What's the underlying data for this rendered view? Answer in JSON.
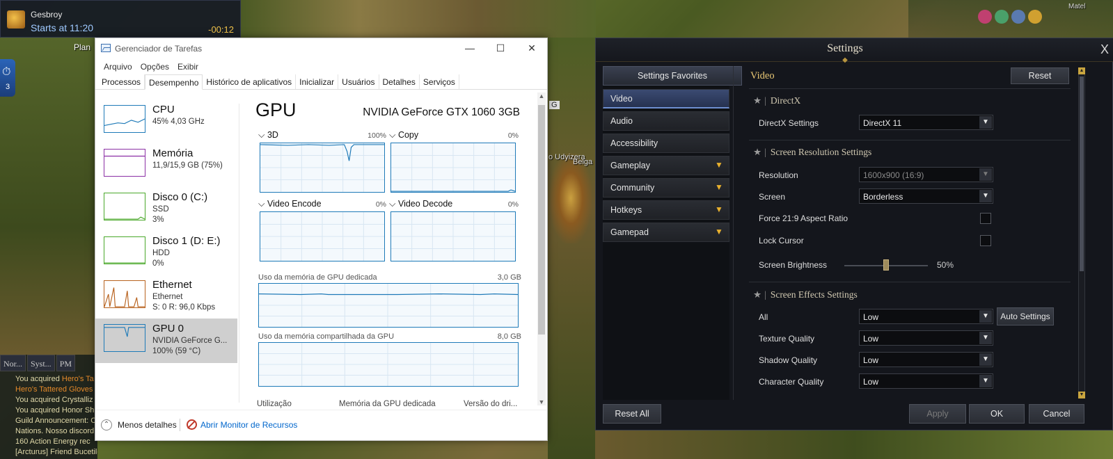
{
  "game_hud": {
    "event_name": "Gesbroy",
    "event_starts": "Starts at 11:20",
    "event_countdown": "-00:12",
    "plan_label": "Plan",
    "left_icon_count": "3",
    "chat_tabs": [
      "Nor...",
      "Syst...",
      "PM"
    ],
    "chat_lines": [
      {
        "text": "You acquired ",
        "hl": "Hero's Ta"
      },
      {
        "text": "",
        "hl": "Hero's Tattered Gloves"
      },
      {
        "text": "You acquired Crystalliz",
        "hl": ""
      },
      {
        "text": "You acquired Honor Sh",
        "hl": ""
      },
      {
        "text": "Guild Announcement: C",
        "hl": ""
      },
      {
        "text": "Nations. Nosso discord",
        "hl": ""
      },
      {
        "text": "160 Action Energy rec",
        "hl": ""
      },
      {
        "text": "[Arcturus] Friend Bucetildez has logged out",
        "hl": ""
      }
    ],
    "world_labels": {
      "udyizera": "o Udyizera",
      "belga": "Belga",
      "g_key": "G",
      "corner": "Matel"
    }
  },
  "task_manager": {
    "title": "Gerenciador de Tarefas",
    "window_buttons": {
      "minimize": "—",
      "maximize": "☐",
      "close": "✕"
    },
    "menu": [
      "Arquivo",
      "Opções",
      "Exibir"
    ],
    "tabs": [
      "Processos",
      "Desempenho",
      "Histórico de aplicativos",
      "Inicializar",
      "Usuários",
      "Detalhes",
      "Serviços"
    ],
    "active_tab": "Desempenho",
    "sidebar": [
      {
        "name": "CPU",
        "sub1": "45% 4,03 GHz",
        "sub2": "",
        "sub3": "",
        "color": "#1e7ab8"
      },
      {
        "name": "Memória",
        "sub1": "11,9/15,9 GB (75%)",
        "sub2": "",
        "sub3": "",
        "color": "#8b2fa5"
      },
      {
        "name": "Disco 0 (C:)",
        "sub1": "SSD",
        "sub2": "3%",
        "sub3": "",
        "color": "#4aa82a"
      },
      {
        "name": "Disco 1 (D: E:)",
        "sub1": "HDD",
        "sub2": "0%",
        "sub3": "",
        "color": "#4aa82a"
      },
      {
        "name": "Ethernet",
        "sub1": "Ethernet",
        "sub2": "S: 0 R: 96,0 Kbps",
        "sub3": "",
        "color": "#b8621e"
      },
      {
        "name": "GPU 0",
        "sub1": "NVIDIA GeForce G...",
        "sub2": "100% (59 °C)",
        "sub3": "",
        "color": "#1e7ab8"
      }
    ],
    "gpu": {
      "title": "GPU",
      "model": "NVIDIA GeForce GTX 1060 3GB",
      "engines": [
        {
          "label": "3D",
          "pct": "100%"
        },
        {
          "label": "Copy",
          "pct": "0%"
        },
        {
          "label": "Video Encode",
          "pct": "0%"
        },
        {
          "label": "Video Decode",
          "pct": "0%"
        }
      ],
      "dedicated_label": "Uso da memória de GPU dedicada",
      "dedicated_max": "3,0 GB",
      "shared_label": "Uso da memória compartilhada da GPU",
      "shared_max": "8,0 GB",
      "bottom_cols": [
        "Utilização",
        "Memória da GPU dedicada",
        "Versão do dri..."
      ]
    },
    "footer": {
      "less": "Menos detalhes",
      "resource_monitor": "Abrir Monitor de Recursos"
    }
  },
  "settings": {
    "title": "Settings",
    "close": "X",
    "favorites": "Settings Favorites",
    "categories": [
      {
        "label": "Video",
        "active": true,
        "expandable": false
      },
      {
        "label": "Audio",
        "active": false,
        "expandable": false
      },
      {
        "label": "Accessibility",
        "active": false,
        "expandable": false
      },
      {
        "label": "Gameplay",
        "active": false,
        "expandable": true
      },
      {
        "label": "Community",
        "active": false,
        "expandable": true
      },
      {
        "label": "Hotkeys",
        "active": false,
        "expandable": true
      },
      {
        "label": "Gamepad",
        "active": false,
        "expandable": true
      }
    ],
    "panel_title": "Video",
    "reset": "Reset",
    "sections": {
      "directx": "DirectX",
      "resolution": "Screen Resolution Settings",
      "effects": "Screen Effects Settings"
    },
    "directx_label": "DirectX Settings",
    "directx_value": "DirectX 11",
    "resolution_label": "Resolution",
    "resolution_value": "1600x900 (16:9)",
    "screen_label": "Screen",
    "screen_value": "Borderless",
    "force_label": "Force 21:9 Aspect Ratio",
    "lock_label": "Lock Cursor",
    "brightness_label": "Screen Brightness",
    "brightness_value": "50%",
    "brightness_level": 0.5,
    "all_label": "All",
    "all_value": "Low",
    "auto_settings": "Auto Settings",
    "texture_label": "Texture Quality",
    "texture_value": "Low",
    "shadow_label": "Shadow Quality",
    "shadow_value": "Low",
    "character_label": "Character Quality",
    "character_value": "Low",
    "footer": {
      "reset_all": "Reset All",
      "apply": "Apply",
      "ok": "OK",
      "cancel": "Cancel"
    },
    "accent": "#e9b12e"
  }
}
